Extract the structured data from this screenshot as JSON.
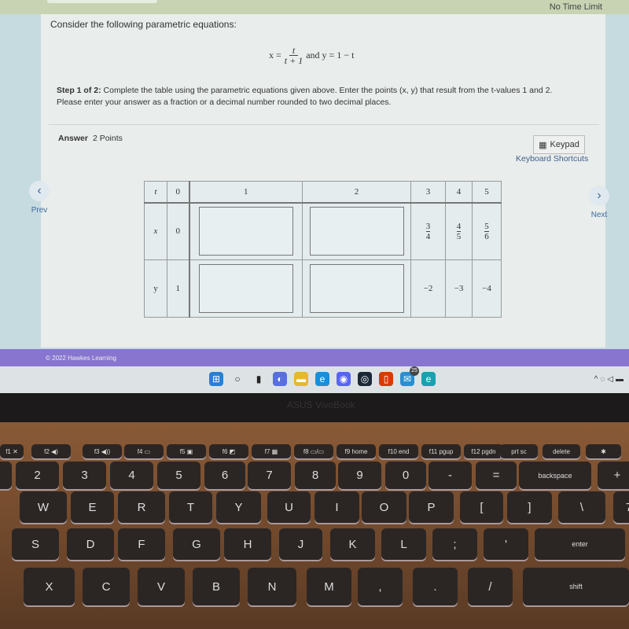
{
  "header": {
    "time_limit": "No Time Limit"
  },
  "question": {
    "intro": "Consider the following parametric equations:",
    "equation": {
      "x_lhs": "x =",
      "x_num": "t",
      "x_den": "t + 1",
      "connector": "and y = 1 − t"
    },
    "step_label": "Step 1 of 2:",
    "step_text": "Complete the table using the parametric equations given above. Enter the points (x, y) that result from the t-values 1 and 2. Please enter your answer as a fraction or a decimal number rounded to two decimal places."
  },
  "answer": {
    "label": "Answer",
    "points": "2 Points",
    "keypad": "Keypad",
    "shortcuts": "Keyboard Shortcuts"
  },
  "nav": {
    "prev": "Prev",
    "next": "Next",
    "prev_icon": "chevron-left",
    "next_icon": "chevron-right"
  },
  "table": {
    "t": [
      "t",
      "0",
      "1",
      "2",
      "3",
      "4",
      "5"
    ],
    "x": {
      "label": "x",
      "v0": "0",
      "v3": [
        "3",
        "4"
      ],
      "v4": [
        "4",
        "5"
      ],
      "v5": [
        "5",
        "6"
      ],
      "in1": "",
      "in2": ""
    },
    "y": {
      "label": "y",
      "v0": "1",
      "v3": "−2",
      "v4": "−3",
      "v5": "−4",
      "in1": "",
      "in2": ""
    }
  },
  "footer": {
    "copyright": "© 2022 Hawkes Learning"
  },
  "taskbar": {
    "icons": [
      "windows",
      "search",
      "task-view",
      "chat",
      "file-explorer",
      "edge",
      "discord",
      "steam",
      "office",
      "mail",
      "edge-beta"
    ],
    "badge": "25"
  },
  "laptop": {
    "brand": "ASUS VivoBook"
  },
  "keyboard": {
    "fn": [
      "f1 ✕",
      "f2 ◀)",
      "f3 ◀))",
      "f4 ▭",
      "f5 ▣",
      "f6 ◩",
      "f7 ▦",
      "f8 ▭/▭",
      "f9 home",
      "f10 end",
      "f11 pgup",
      "f12 pgdn",
      "prt sc",
      "delete",
      "✱"
    ],
    "num": [
      "",
      "2",
      "3",
      "4",
      "5",
      "6",
      "7",
      "8",
      "9",
      "0",
      "-",
      "=",
      "backspace",
      "+"
    ],
    "q": [
      "W",
      "E",
      "R",
      "T",
      "Y",
      "U",
      "I",
      "O",
      "P",
      "[",
      "]",
      "\\",
      "7"
    ],
    "a": [
      "S",
      "D",
      "F",
      "G",
      "H",
      "J",
      "K",
      "L",
      ";",
      "'",
      "enter"
    ],
    "z": [
      "X",
      "C",
      "V",
      "B",
      "N",
      "M",
      ",",
      ".",
      "/",
      "shift"
    ]
  }
}
